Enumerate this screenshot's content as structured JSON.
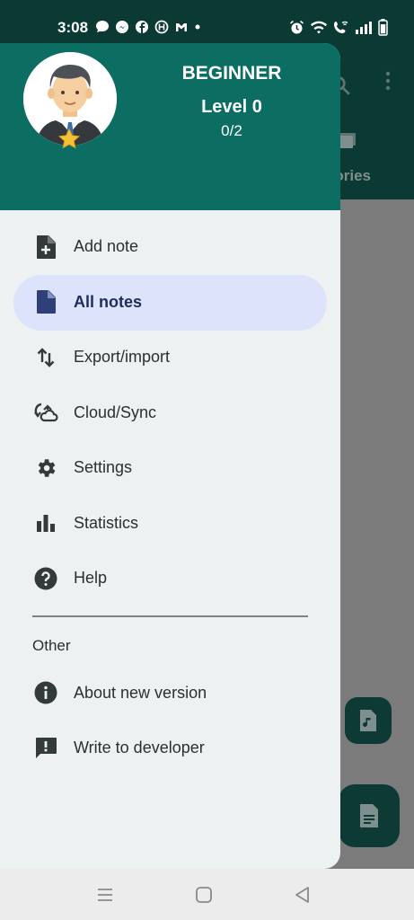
{
  "status_bar": {
    "time": "3:08",
    "left_icons": [
      "chat-bubble-icon",
      "messenger-icon",
      "facebook-icon",
      "hub-icon",
      "gmail-icon",
      "dot-icon"
    ],
    "right_icons": [
      "alarm-icon",
      "wifi-icon",
      "wifi-call-icon",
      "signal-icon",
      "battery-icon"
    ]
  },
  "drawer": {
    "header": {
      "level_name": "BEGINNER",
      "level": "Level 0",
      "progress": "0/2"
    },
    "items": [
      {
        "label": "Add note",
        "icon": "note-add-icon"
      },
      {
        "label": "All notes",
        "icon": "note-icon",
        "active": true
      },
      {
        "label": "Export/import",
        "icon": "swap-vert-icon"
      },
      {
        "label": "Cloud/Sync",
        "icon": "cloud-sync-icon"
      },
      {
        "label": "Settings",
        "icon": "gear-icon"
      },
      {
        "label": "Statistics",
        "icon": "bar-chart-icon"
      },
      {
        "label": "Help",
        "icon": "help-icon"
      }
    ],
    "other_section": {
      "title": "Other",
      "items": [
        {
          "label": "About new version",
          "icon": "info-icon"
        },
        {
          "label": "Write to developer",
          "icon": "feedback-icon"
        }
      ]
    }
  },
  "background": {
    "categories_label": "gories"
  },
  "colors": {
    "header": "#0c6e62",
    "active_pill": "#dce3fb",
    "dark_teal": "#0b3a35"
  }
}
